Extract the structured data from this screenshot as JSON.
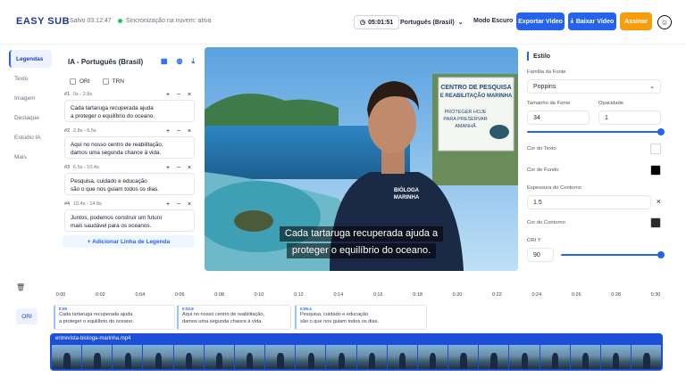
{
  "header": {
    "logo": "EASY SUB",
    "saved": "Salvo 03:12:47",
    "sync": "Sincronização na nuvem: ativa",
    "timer": "05:01:51",
    "language": "Português (Brasil)",
    "dark_mode": "Modo Escuro",
    "export": "Exportar Vídeo",
    "download": "Baixar Vídeo",
    "sign": "Assinar",
    "colors": {
      "primary": "#2563eb",
      "accent": "#f59e0b",
      "ok": "#22c55e"
    }
  },
  "nav": [
    "Legendas",
    "Texto",
    "Imagem",
    "Destaque",
    "Estúdio IA",
    "Mais"
  ],
  "captions": {
    "title": "IA - Português (Brasil)",
    "check_ori": "ORI",
    "check_trn": "TRN",
    "cues": [
      {
        "idx": "#1",
        "range": "0s - 2.8s",
        "text1": "Cada tartaruga recuperada ajuda",
        "text2": "a proteger o equilíbrio do oceano."
      },
      {
        "idx": "#2",
        "range": "2.8s - 6.5s",
        "text1": "Aqui no nosso centro de reabilitação,",
        "text2": "damos uma segunda chance à vida."
      },
      {
        "idx": "#3",
        "range": "6.5s - 10.4s",
        "text1": "Pesquisa, cuidado e educação",
        "text2": "são o que nos guiam todos os dias."
      },
      {
        "idx": "#4",
        "range": "10.4s - 14.8s",
        "text1": "Juntos, podemos construir um futuro",
        "text2": "mais saudável para os oceanos."
      }
    ],
    "add_line": "+ Adicionar Linha de Legenda"
  },
  "video": {
    "subtitle1": "Cada tartaruga recuperada ajuda a",
    "subtitle2": "proteger o equilíbrio do oceano.",
    "sign1": "CENTRO DE PESQUISA",
    "sign2": "E REABILITAÇÃO MARINHA",
    "sign3": "PROTEGER HOJE",
    "sign4": "PARA PRESERVAR",
    "sign5": "AMANHÃ",
    "shirt1": "BIÓLOGA",
    "shirt2": "MARINHA"
  },
  "style": {
    "title": "Estilo",
    "font_family_label": "Família da Fonte",
    "font_family": "Poppins",
    "font_size_label": "Tamanho da Fonte",
    "font_size": "34",
    "opacity_label": "Opacidade",
    "opacity": "1",
    "opacity_level": 1.0,
    "text_color_label": "Cor do Texto",
    "text_color": "#ffffff",
    "bg_color_label": "Cor de Fundo",
    "bg_color": "#000000",
    "outline_label": "Espessura do Contorno",
    "outline": "1.5",
    "outline_color_label": "Cor do Contorno",
    "outline_color": "#2b2b2b",
    "ori_y_label": "ORI Y",
    "ori_y": "90",
    "ori_y_level": 1.0
  },
  "timeline": {
    "ticks": [
      "0:00",
      "0:02",
      "0:04",
      "0:06",
      "0:08",
      "0:10",
      "0:12",
      "0:14",
      "0:16",
      "0:18",
      "0:20",
      "0:22",
      "0:24",
      "0:26",
      "0:28",
      "0:30"
    ],
    "track_label": "ORI",
    "blocks": [
      {
        "t": "0:00",
        "x1": "Cada tartaruga recuperada ajuda",
        "x2": "a proteger o equilíbrio do oceano."
      },
      {
        "t": "0:02.8",
        "x1": "Aqui no nosso centro de reabilitação,",
        "x2": "damos uma segunda chance à vida."
      },
      {
        "t": "0:06.4",
        "x1": "Pesquisa, cuidado e educação",
        "x2": "são o que nos guiam todos os dias."
      }
    ],
    "clip_name": "entrevista-biologa-marinha.mp4"
  }
}
